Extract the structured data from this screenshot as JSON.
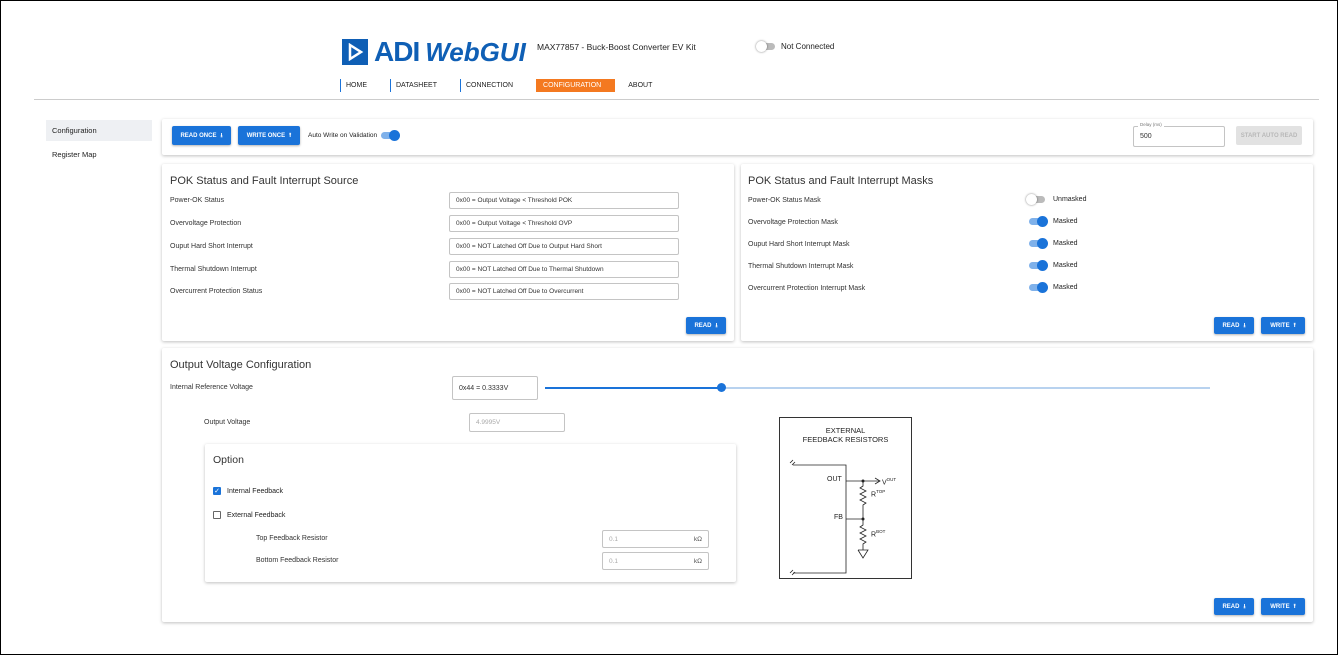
{
  "header": {
    "logo_adi": "ADI",
    "logo_web": "WebGUI",
    "kit_title": "MAX77857 - Buck-Boost Converter EV Kit",
    "connection_status": "Not Connected"
  },
  "nav": [
    "HOME",
    "DATASHEET",
    "CONNECTION",
    "CONFIGURATION",
    "ABOUT"
  ],
  "sidebar": {
    "items": [
      "Configuration",
      "Register Map"
    ]
  },
  "toolbar": {
    "read_once": "READ ONCE",
    "write_once": "WRITE ONCE",
    "auto_write_label": "Auto Write on Validation",
    "delay_label": "Delay (ms)",
    "delay_value": "500",
    "start_auto_read": "START AUTO READ"
  },
  "pok_source": {
    "title": "POK Status and Fault Interrupt Source",
    "rows": [
      {
        "label": "Power-OK Status",
        "value": "0x00 = Output Voltage < Threshold POK"
      },
      {
        "label": "Overvoltage Protection",
        "value": "0x00 = Output Voltage < Threshold OVP"
      },
      {
        "label": "Ouput Hard Short Interrupt",
        "value": "0x00 = NOT Latched Off Due to Output Hard Short"
      },
      {
        "label": "Thermal Shutdown Interrupt",
        "value": "0x00 = NOT Latched Off Due to Thermal Shutdown"
      },
      {
        "label": "Overcurrent Protection Status",
        "value": "0x00 = NOT Latched Off Due to Overcurrent"
      }
    ],
    "read_label": "READ"
  },
  "pok_masks": {
    "title": "POK Status and Fault Interrupt Masks",
    "rows": [
      {
        "label": "Power-OK Status Mask",
        "state": "Unmasked"
      },
      {
        "label": "Overvoltage Protection Mask",
        "state": "Masked"
      },
      {
        "label": "Ouput Hard Short Interrupt Mask",
        "state": "Masked"
      },
      {
        "label": "Thermal Shutdown Interrupt Mask",
        "state": "Masked"
      },
      {
        "label": "Overcurrent Protection Interrupt Mask",
        "state": "Masked"
      }
    ],
    "read_label": "READ",
    "write_label": "WRITE"
  },
  "output_voltage": {
    "title": "Output Voltage Configuration",
    "ref_label": "Internal Reference Voltage",
    "ref_value": "0x44 = 0.3333V",
    "slider_fraction": 0.265,
    "out_label": "Output Voltage",
    "out_value": "4.9995V",
    "option": {
      "title": "Option",
      "internal_feedback": "Internal Feedback",
      "external_feedback": "External Feedback",
      "top_label": "Top Feedback Resistor",
      "top_value": "0.1",
      "bottom_label": "Bottom Feedback Resistor",
      "bottom_value": "0.1",
      "unit": "kΩ"
    },
    "diagram": {
      "title_line1": "EXTERNAL",
      "title_line2": "FEEDBACK RESISTORS",
      "out": "OUT",
      "fb": "FB",
      "vout": "V",
      "vout_sub": "OUT",
      "rtop": "R",
      "rtop_sub": "TOP",
      "rbot": "R",
      "rbot_sub": "BOT"
    },
    "read_label": "READ",
    "write_label": "WRITE"
  },
  "colors": {
    "accent": "#1a73d9",
    "nav_active": "#f47920",
    "brand": "#0f5fb5"
  }
}
